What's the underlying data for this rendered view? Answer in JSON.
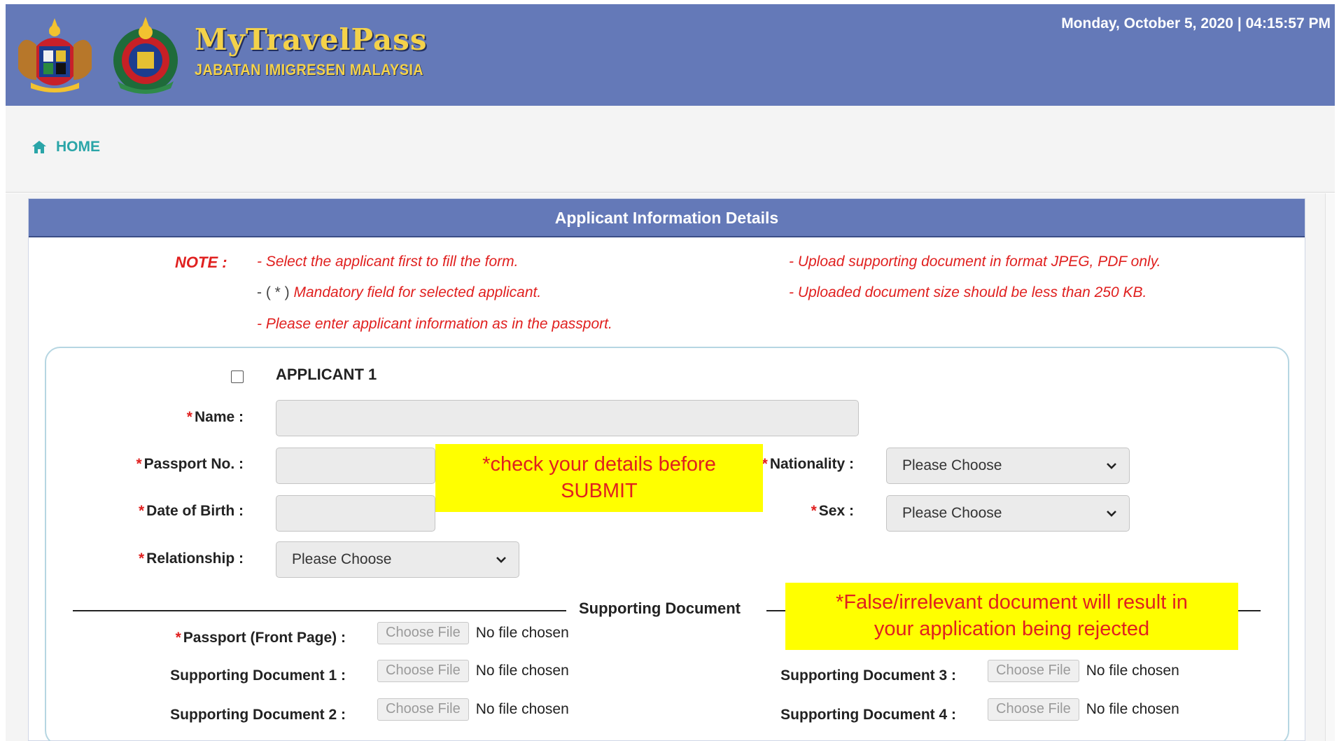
{
  "header": {
    "brand_title": "MyTravelPass",
    "brand_subtitle": "JABATAN IMIGRESEN MALAYSIA",
    "datetime": "Monday, October 5, 2020 | 04:15:57 PM",
    "emblem1_icon": "malaysia-coat-of-arms-icon",
    "emblem2_icon": "immigration-crest-icon"
  },
  "nav": {
    "home_label": "HOME",
    "home_icon": "home-icon"
  },
  "panel": {
    "title": "Applicant Information Details"
  },
  "notes": {
    "label": "NOTE :",
    "items": [
      "- Select the applicant first to fill the form.",
      "Mandatory field for selected applicant.",
      "- Please enter applicant information as in the passport.",
      "- Upload supporting document in format JPEG, PDF only.",
      "- Uploaded document size should be less than 250 KB."
    ],
    "mandatory_prefix": "- ( * )"
  },
  "applicant": {
    "title": "APPLICANT 1",
    "checked": false,
    "fields": {
      "name_label": "Name :",
      "passport_label": "Passport No. :",
      "nationality_label": "Nationality :",
      "nationality_value": "Please Choose",
      "dob_label": "Date of Birth :",
      "sex_label": "Sex :",
      "sex_value": "Please Choose",
      "relationship_label": "Relationship :",
      "relationship_value": "Please Choose"
    }
  },
  "supporting": {
    "title": "Supporting Document",
    "choose_file": "Choose File",
    "no_file": "No file chosen",
    "passport_front_label": "Passport (Front Page) :",
    "doc1_label": "Supporting Document 1 :",
    "doc2_label": "Supporting Document 2 :",
    "doc3_label": "Supporting Document 3 :",
    "doc4_label": "Supporting Document 4 :"
  },
  "callouts": {
    "check_line1": "*check your details before",
    "check_line2": "SUBMIT",
    "false_line1": "*False/irrelevant document will result in",
    "false_line2": "your application being rejected"
  },
  "colors": {
    "header_bg": "#6479b8",
    "brand_gold": "#f4d24a",
    "note_red": "#e0201f",
    "home_teal": "#2aa5a8",
    "callout_yellow": "#ffff00"
  }
}
